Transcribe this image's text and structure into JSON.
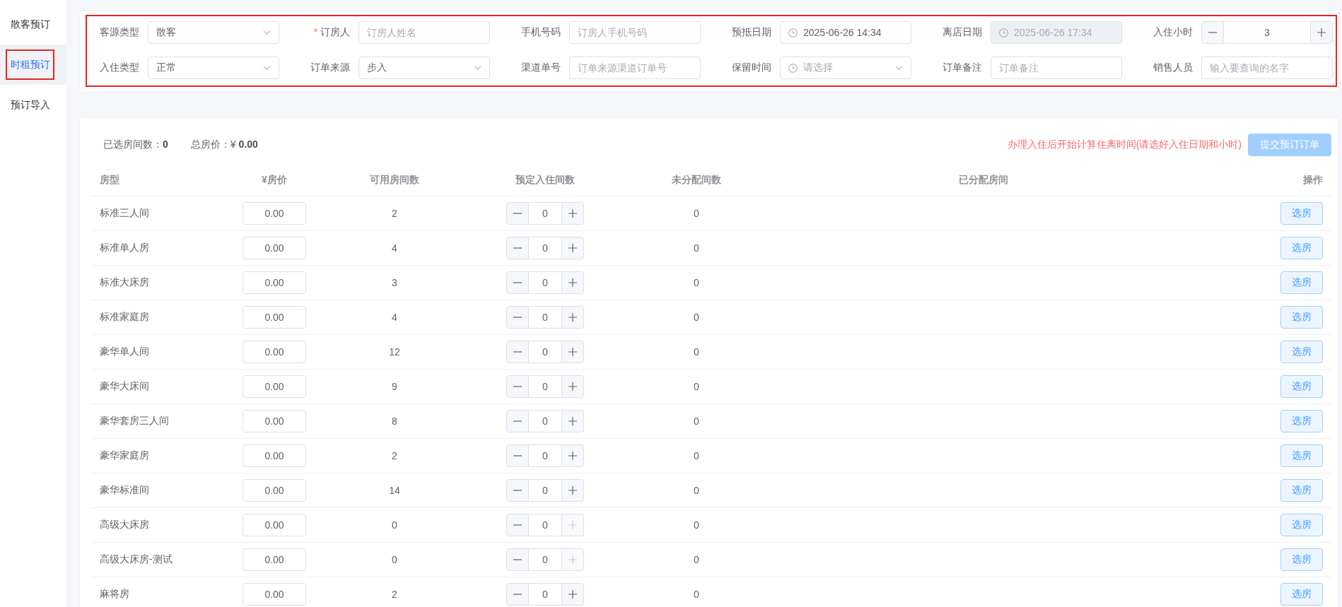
{
  "sidebar": {
    "items": [
      {
        "label": "散客预订",
        "selected": false,
        "highlighted": false
      },
      {
        "label": "时租预订",
        "selected": true,
        "highlighted": true
      },
      {
        "label": "预订导入",
        "selected": false,
        "highlighted": false
      }
    ]
  },
  "form": {
    "highlighted": true,
    "fields": [
      {
        "kind": "select",
        "label": "客源类型",
        "value": "散客",
        "disabled": false
      },
      {
        "kind": "text",
        "label": "订房人",
        "mark": "*",
        "placeholder": "订房人姓名",
        "disabled": false
      },
      {
        "kind": "text",
        "label": "手机号码",
        "placeholder": "订房人手机号码",
        "disabled": false
      },
      {
        "kind": "datetime",
        "label": "预抵日期",
        "value": "2025-06-26 14:34",
        "disabled": false
      },
      {
        "kind": "datetime",
        "label": "离店日期",
        "value": "2025-06-26 17:34",
        "disabled": true
      },
      {
        "kind": "stepper",
        "label": "入住小时",
        "value": "3",
        "disabled": false
      },
      {
        "kind": "select",
        "label": "入住类型",
        "value": "正常",
        "disabled": false
      },
      {
        "kind": "select",
        "label": "订单来源",
        "value": "步入",
        "disabled": false
      },
      {
        "kind": "text",
        "label": "渠道单号",
        "placeholder": "订单来源渠道订单号",
        "disabled": false
      },
      {
        "kind": "time-select",
        "label": "保留时间",
        "placeholder": "请选择",
        "disabled": false
      },
      {
        "kind": "text",
        "label": "订单备注",
        "placeholder": "订单备注",
        "disabled": false
      },
      {
        "kind": "text",
        "label": "销售人员",
        "placeholder": "输入要查询的名字",
        "disabled": false
      }
    ]
  },
  "summary": [
    "已选房间数：**0**",
    "总房价：¥ **0.00**"
  ],
  "notice": "办理入住后开始计算住离时间(请选好入住日期和小时)",
  "submit_button": {
    "label": "提交预订订单",
    "disabled": true
  },
  "table": {
    "columns": [
      "房型",
      "¥房价",
      "可用房间数",
      "预定入住间数",
      "未分配间数",
      "已分配房间",
      "操作"
    ],
    "rows": [
      {
        "room_type": "标准三人间",
        "price": "0.00",
        "available": "2",
        "count": "0",
        "increase_disabled": false,
        "unassigned": "0",
        "action": "选房"
      },
      {
        "room_type": "标准单人房",
        "price": "0.00",
        "available": "4",
        "count": "0",
        "increase_disabled": false,
        "unassigned": "0",
        "action": "选房"
      },
      {
        "room_type": "标准大床房",
        "price": "0.00",
        "available": "3",
        "count": "0",
        "increase_disabled": false,
        "unassigned": "0",
        "action": "选房"
      },
      {
        "room_type": "标准家庭房",
        "price": "0.00",
        "available": "4",
        "count": "0",
        "increase_disabled": false,
        "unassigned": "0",
        "action": "选房"
      },
      {
        "room_type": "豪华单人间",
        "price": "0.00",
        "available": "12",
        "count": "0",
        "increase_disabled": false,
        "unassigned": "0",
        "action": "选房"
      },
      {
        "room_type": "豪华大床间",
        "price": "0.00",
        "available": "9",
        "count": "0",
        "increase_disabled": false,
        "unassigned": "0",
        "action": "选房"
      },
      {
        "room_type": "豪华套房三人间",
        "price": "0.00",
        "available": "8",
        "count": "0",
        "increase_disabled": false,
        "unassigned": "0",
        "action": "选房"
      },
      {
        "room_type": "豪华家庭房",
        "price": "0.00",
        "available": "2",
        "count": "0",
        "increase_disabled": false,
        "unassigned": "0",
        "action": "选房"
      },
      {
        "room_type": "豪华标准间",
        "price": "0.00",
        "available": "14",
        "count": "0",
        "increase_disabled": false,
        "unassigned": "0",
        "action": "选房"
      },
      {
        "room_type": "高级大床房",
        "price": "0.00",
        "available": "0",
        "count": "0",
        "increase_disabled": true,
        "unassigned": "0",
        "action": "选房"
      },
      {
        "room_type": "高级大床房-测试",
        "price": "0.00",
        "available": "0",
        "count": "0",
        "increase_disabled": true,
        "unassigned": "0",
        "action": "选房"
      },
      {
        "room_type": "麻将房",
        "price": "0.00",
        "available": "2",
        "count": "0",
        "increase_disabled": false,
        "unassigned": "0",
        "action": "选房"
      }
    ]
  }
}
